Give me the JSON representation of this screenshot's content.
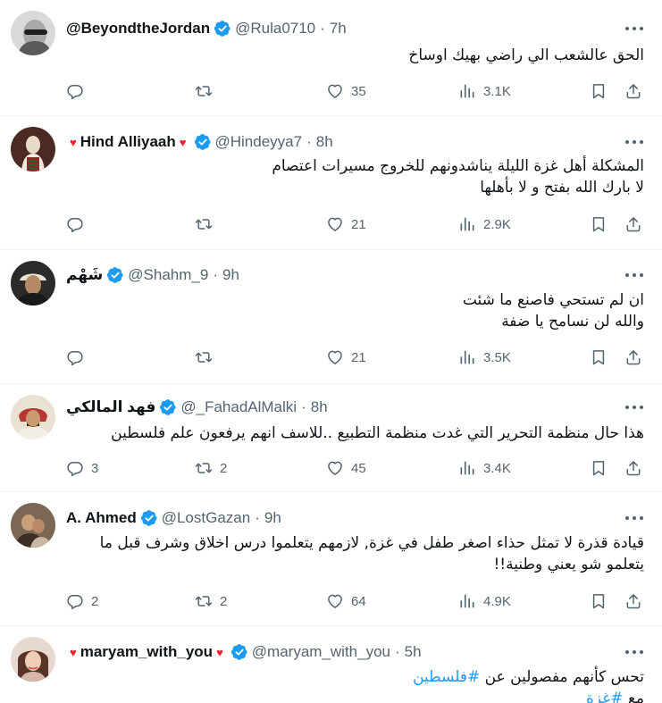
{
  "tweets": [
    {
      "name": "@BeyondtheJordan",
      "hearts": false,
      "handle": "@Rula0710",
      "time": "7h",
      "lines": [
        "الحق عالشعب الي راضي بهيك اوساخ"
      ],
      "replies": "",
      "retweets": "",
      "likes": "35",
      "views": "3.1K"
    },
    {
      "name": "Hind Alliyaah",
      "hearts": true,
      "heart_glyph": "♥",
      "handle": "@Hindeyya7",
      "time": "8h",
      "lines": [
        "المشكلة أهل غزة الليلة يناشدونهم للخروج مسيرات اعتصام",
        "لا بارك الله بفتح و لا بأهلها"
      ],
      "replies": "",
      "retweets": "",
      "likes": "21",
      "views": "2.9K"
    },
    {
      "name": "شَهْم",
      "hearts": false,
      "handle": "@Shahm_9",
      "time": "9h",
      "lines": [
        "ان لم تستحي فاصنع ما شئت",
        "والله لن نسامح يا ضفة"
      ],
      "replies": "",
      "retweets": "",
      "likes": "21",
      "views": "3.5K"
    },
    {
      "name": "فهد المالكي",
      "hearts": false,
      "handle": "@_FahadAlMalki",
      "time": "8h",
      "lines": [
        "هذا حال منظمة التحرير التي غدت منظمة التطبيع ..للاسف انهم يرفعون علم فلسطين"
      ],
      "replies": "3",
      "retweets": "2",
      "likes": "45",
      "views": "3.4K"
    },
    {
      "name": "A. Ahmed",
      "hearts": false,
      "handle": "@LostGazan",
      "time": "9h",
      "lines": [
        "قيادة قذرة لا تمثل حذاء اصغر طفل في غزة, لازمهم يتعلموا درس اخلاق وشرف قبل ما",
        "يتعلمو شو يعني وطنية!!"
      ],
      "replies": "2",
      "retweets": "2",
      "likes": "64",
      "views": "4.9K"
    },
    {
      "name": "maryam_with_you",
      "hearts": true,
      "heart_glyph": "♥",
      "handle": "@maryam_with_you",
      "time": "5h",
      "line1_text": "تحس كأنهم مفصولين عن ",
      "hashtag1": "#فلسطين",
      "line2_text": "مع ",
      "hashtag2": "#غزة"
    }
  ],
  "separator": "·",
  "colors": {
    "text": "#0f1419",
    "secondary": "#536471",
    "verified": "#1d9bf0",
    "heart": "#f4212e",
    "divider": "#eff3f4"
  },
  "icons": [
    "more-icon",
    "verified-badge-icon",
    "reply-icon",
    "retweet-icon",
    "like-icon",
    "views-icon",
    "bookmark-icon",
    "share-icon"
  ]
}
